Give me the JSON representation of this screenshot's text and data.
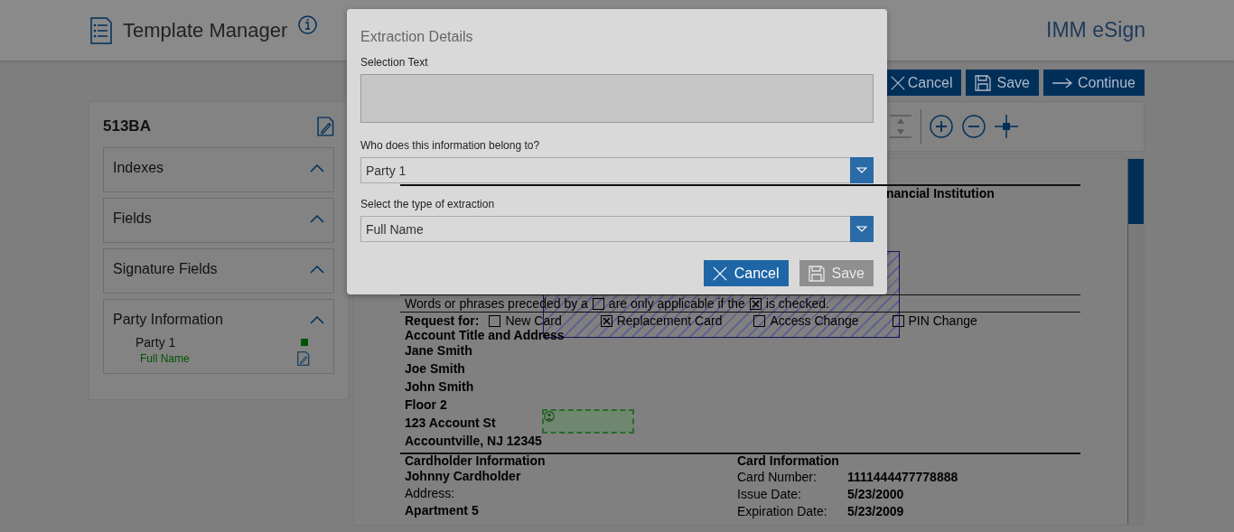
{
  "header": {
    "title": "Template Manager",
    "brand": "IMM eSign"
  },
  "actions": [
    {
      "kind": "cancel",
      "label": "Cancel"
    },
    {
      "kind": "save",
      "label": "Save"
    },
    {
      "kind": "continue",
      "label": "Continue"
    }
  ],
  "template": {
    "name": "513BA",
    "sections": [
      {
        "title": "Indexes"
      },
      {
        "title": "Fields"
      },
      {
        "title": "Signature Fields"
      },
      {
        "title": "Party Information",
        "parties": [
          {
            "name": "Party 1",
            "color": "#005300",
            "fields": [
              "Full Name"
            ]
          }
        ]
      }
    ]
  },
  "toolbar": {
    "tools": [
      {
        "kind": "distribute"
      },
      {
        "kind": "separator"
      },
      {
        "kind": "zoom-in"
      },
      {
        "kind": "zoom-out"
      },
      {
        "kind": "fit"
      }
    ]
  },
  "document": {
    "institution": {
      "heading": "nancial Institution"
    },
    "legend": {
      "before": "Words or phrases preceded by a",
      "middle": "are only applicable if the",
      "after": "is checked."
    },
    "request": {
      "label": "Request for:",
      "options": [
        {
          "label": "New Card",
          "checked": false
        },
        {
          "label": "Replacement Card",
          "checked": true
        },
        {
          "label": "Access Change",
          "checked": false
        },
        {
          "label": "PIN Change",
          "checked": false
        }
      ]
    },
    "account": {
      "heading": "Account Title and Address",
      "lines": [
        "Jane Smith",
        "Joe Smith",
        "John Smith",
        "Floor 2",
        "123 Account St",
        "Accountville, NJ 12345"
      ]
    },
    "cardholder": {
      "heading": "Cardholder Information",
      "name": "Johnny Cardholder",
      "address_label": "Address:",
      "lines": [
        "Apartment 5"
      ]
    },
    "card_info": {
      "heading": "Card Information",
      "rows": [
        {
          "label": "Card Number:",
          "value": "1111444477778888"
        },
        {
          "label": "Issue Date:",
          "value": "5/23/2000"
        },
        {
          "label": "Expiration Date:",
          "value": "5/23/2009"
        }
      ]
    }
  },
  "dialog": {
    "title": "Extraction Details",
    "fields": [
      {
        "kind": "textarea",
        "label": "Selection Text"
      },
      {
        "kind": "select",
        "label": "Who does this information belong to?",
        "value": "Party 1"
      },
      {
        "kind": "select",
        "label": "Select the type of extraction",
        "value": "Full Name"
      }
    ],
    "buttons": [
      {
        "kind": "cancel",
        "label": "Cancel",
        "disabled": false
      },
      {
        "kind": "save",
        "label": "Save",
        "disabled": true
      }
    ]
  }
}
